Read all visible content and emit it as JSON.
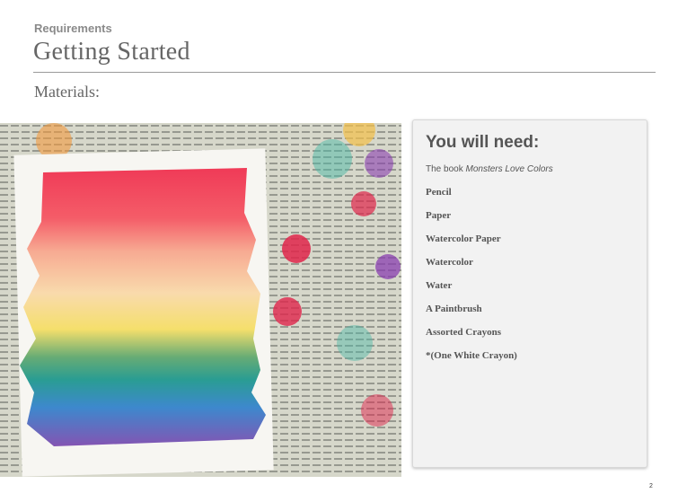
{
  "header": {
    "eyebrow": "Requirements",
    "title": "Getting Started",
    "subtitle": "Materials:"
  },
  "photo": {
    "subject": "Watercolor rainbow painting on newspaper",
    "colors": [
      "#ef2a4a",
      "#f79a7c",
      "#f6df62",
      "#1f9d78",
      "#2f7bc9",
      "#6b3fa5"
    ]
  },
  "sidebar": {
    "heading": "You will need:",
    "book_prefix": "The book ",
    "book_title": "Monsters Love Colors",
    "items": [
      "Pencil",
      "Paper",
      "Watercolor Paper",
      "Watercolor",
      "Water",
      "A Paintbrush",
      "Assorted Crayons",
      "*(One White Crayon)"
    ]
  },
  "footer": {
    "page_number": "2"
  }
}
